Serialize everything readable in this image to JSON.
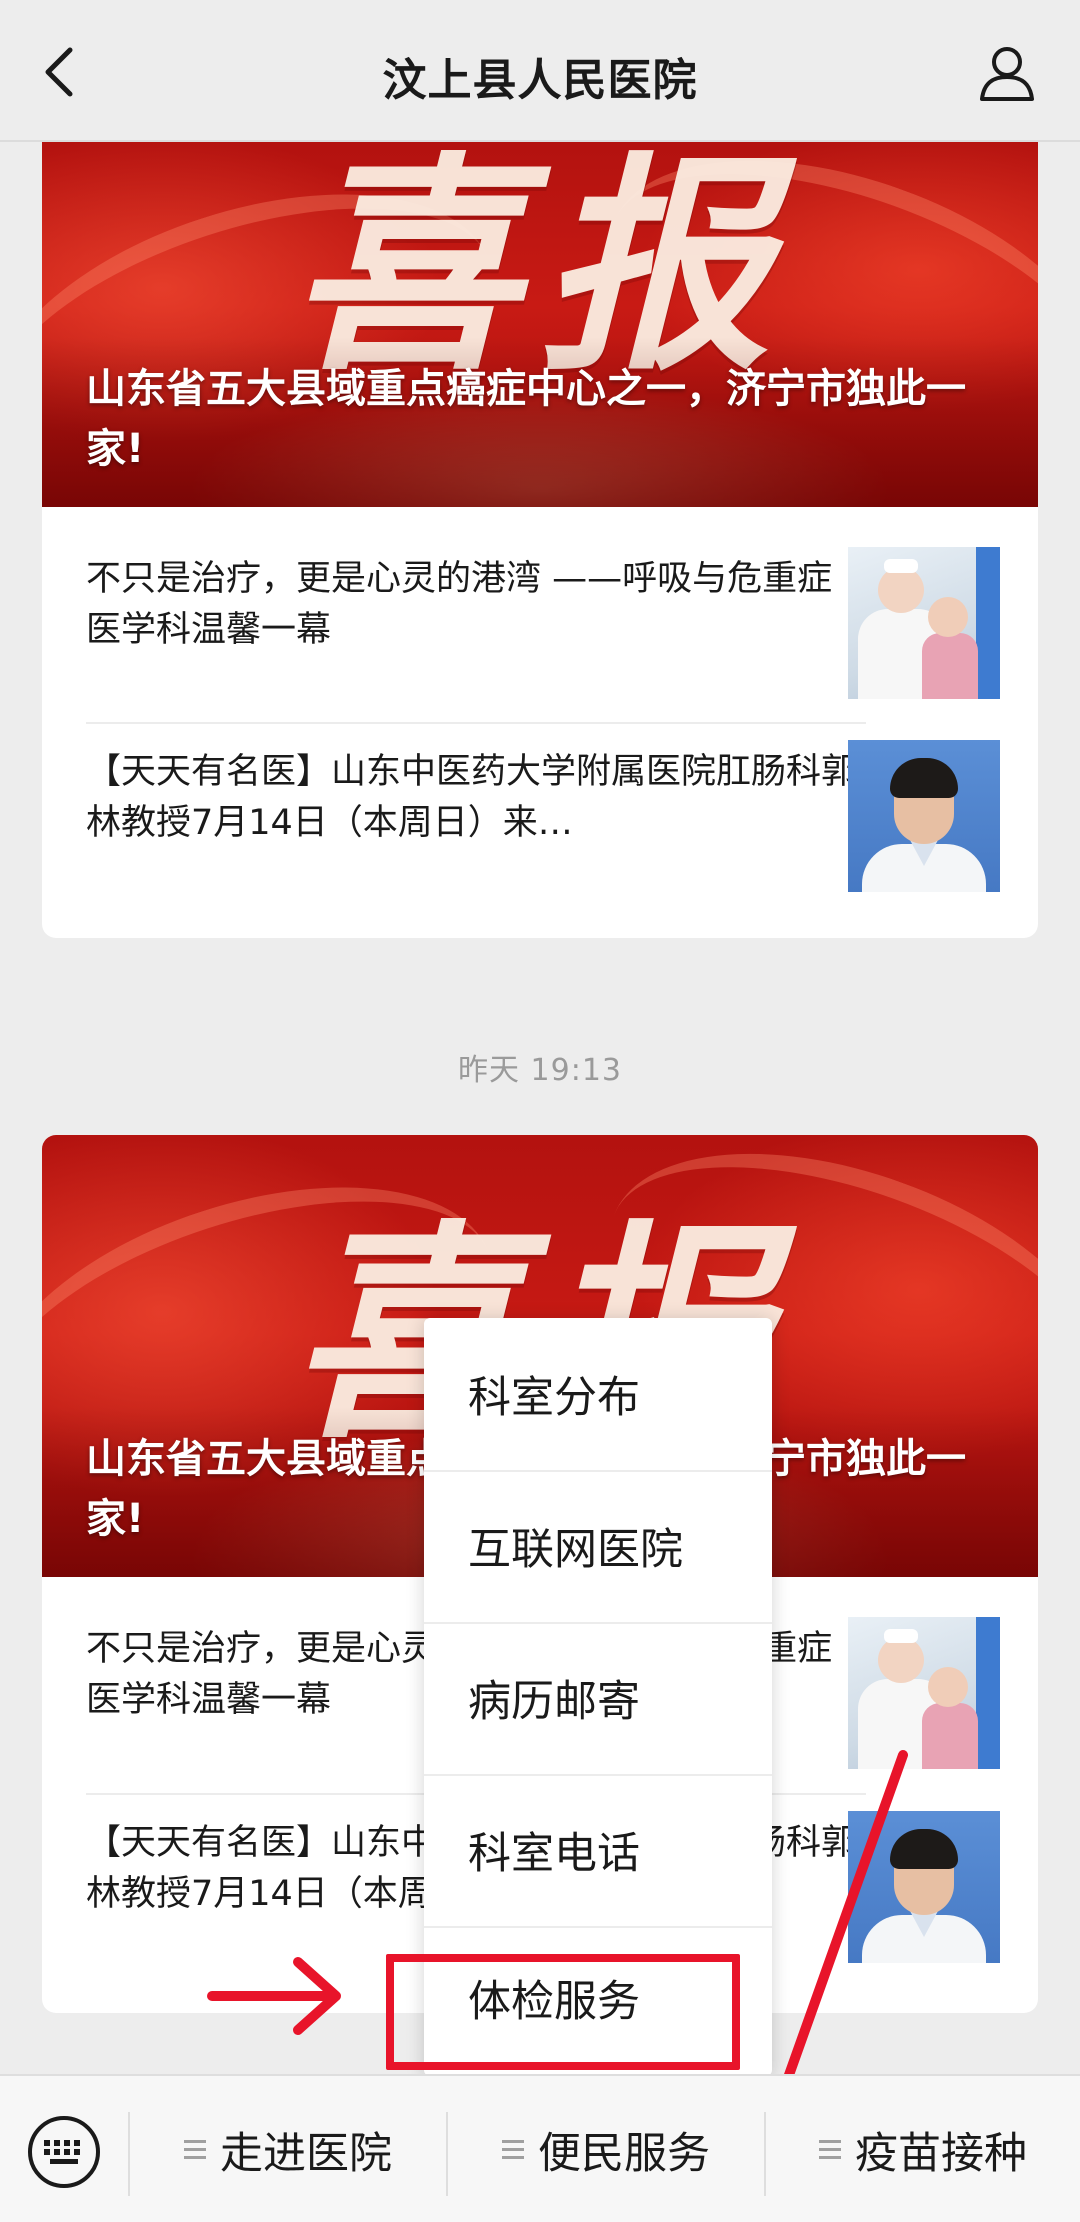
{
  "header": {
    "title": "汶上县人民医院"
  },
  "icons": {
    "back": "chevron-left-icon",
    "profile": "person-icon",
    "keyboard": "keyboard-icon",
    "menu": "hamburger-icon"
  },
  "articles": [
    {
      "hero_big_text": "喜报",
      "headline": "山东省五大县域重点癌症中心之一，济宁市独此一家!",
      "items": [
        {
          "title": "不只是治疗，更是心灵的港湾 ——呼吸与危重症医学科温馨一幕"
        },
        {
          "title": "【天天有名医】山东中医药大学附属医院肛肠科郭林教授7月14日（本周日）来…"
        }
      ]
    },
    {
      "hero_big_text": "喜报",
      "headline": "山东省五大县域重点癌症中心之一，济宁市独此一家!",
      "items": [
        {
          "title": "不只是治疗，更是心灵的港湾 ——呼吸与危重症医学科温馨一幕"
        },
        {
          "title": "【天天有名医】山东中医药大学附属医院肛肠科郭林教授7月14日（本周日）来…"
        }
      ]
    }
  ],
  "timestamp": "昨天 19:13",
  "popup_menu": {
    "items": [
      "科室分布",
      "互联网医院",
      "病历邮寄",
      "科室电话",
      "体检服务"
    ],
    "highlighted": "体检服务"
  },
  "bottom_menu": {
    "tabs": [
      "走进医院",
      "便民服务",
      "疫苗接种"
    ],
    "active": "便民服务"
  },
  "colors": {
    "highlight": "#e8142a",
    "hero_red": "#c81a14",
    "background": "#ededed"
  }
}
